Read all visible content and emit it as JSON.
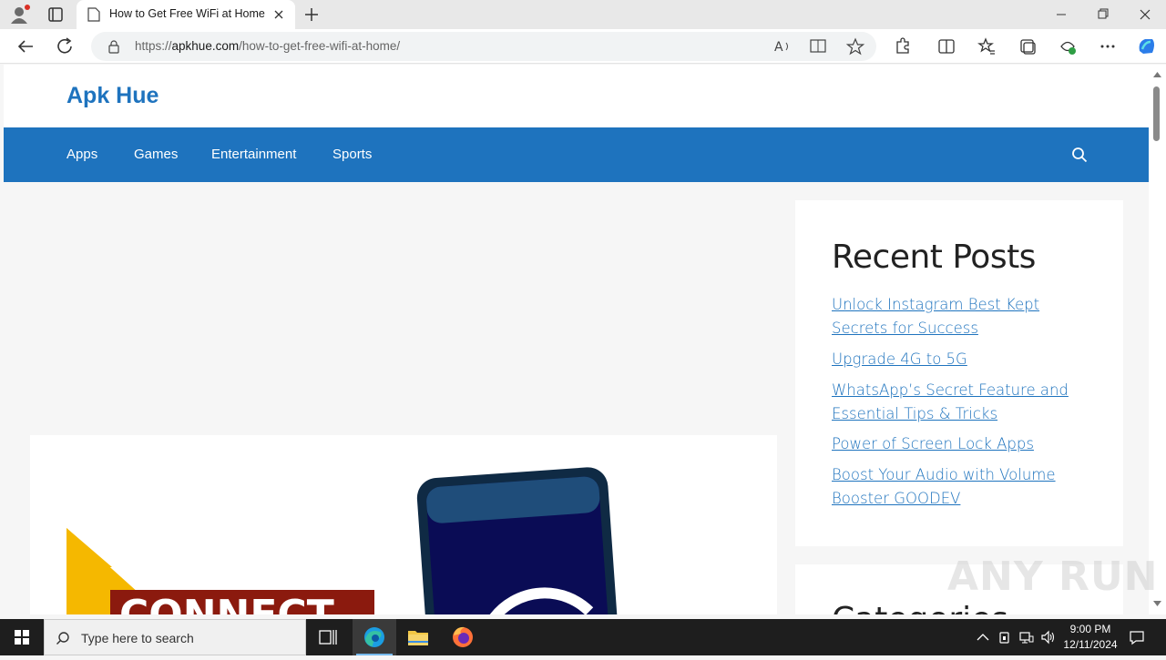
{
  "browser": {
    "tab_title": "How to Get Free WiFi at Home",
    "url_prefix": "https://",
    "url_domain": "apkhue.com",
    "url_path": "/how-to-get-free-wifi-at-home/"
  },
  "site": {
    "title": "Apk Hue",
    "brand_color": "#1e73be",
    "nav": [
      "Apps",
      "Games",
      "Entertainment",
      "Sports"
    ]
  },
  "sidebar": {
    "heading": "Recent Posts",
    "posts": [
      "Unlock Instagram Best Kept Secrets for Success",
      "Upgrade 4G to 5G",
      "WhatsApp’s Secret Feature and Essential Tips & Tricks",
      "Power of Screen Lock Apps",
      "Boost Your Audio with Volume Booster GOODEV"
    ],
    "next_heading_partial": "Categories"
  },
  "watermark": "ANY RUN",
  "taskbar": {
    "search_placeholder": "Type here to search",
    "time": "9:00 PM",
    "date": "12/11/2024"
  }
}
